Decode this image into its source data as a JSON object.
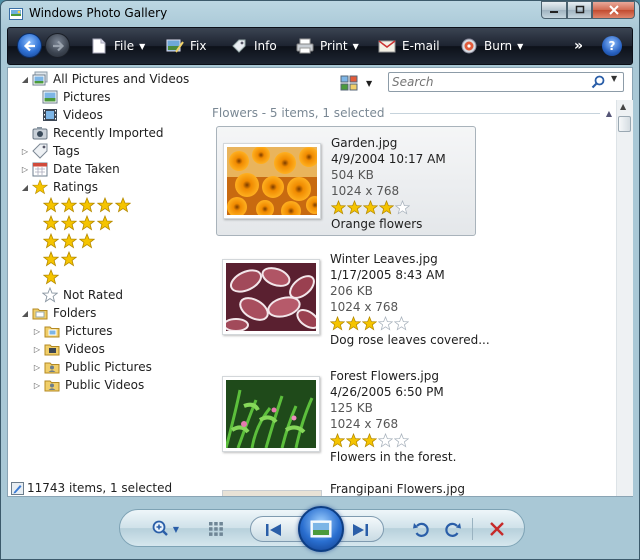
{
  "window": {
    "title": "Windows Photo Gallery"
  },
  "toolbar": {
    "file": "File",
    "fix": "Fix",
    "info": "Info",
    "print": "Print",
    "email": "E-mail",
    "burn": "Burn",
    "more": "»",
    "help": "?"
  },
  "nav": {
    "all": "All Pictures and Videos",
    "pictures": "Pictures",
    "videos": "Videos",
    "recently_imported": "Recently Imported",
    "tags": "Tags",
    "date_taken": "Date Taken",
    "ratings": "Ratings",
    "not_rated": "Not Rated",
    "folders": "Folders",
    "folder_pictures": "Pictures",
    "folder_videos": "Videos",
    "public_pictures": "Public Pictures",
    "public_videos": "Public Videos"
  },
  "status": {
    "text": "11743 items, 1 selected"
  },
  "search": {
    "placeholder": "Search"
  },
  "group": {
    "header": "Flowers - 5 items, 1 selected"
  },
  "photos": [
    {
      "name": "Garden.jpg",
      "date": "4/9/2004 10:17 AM",
      "size": "504 KB",
      "dims": "1024 x 768",
      "rating": 4,
      "caption": "Orange flowers"
    },
    {
      "name": "Winter Leaves.jpg",
      "date": "1/17/2005 8:43 AM",
      "size": "206 KB",
      "dims": "1024 x 768",
      "rating": 3,
      "caption": "Dog rose leaves covered..."
    },
    {
      "name": "Forest Flowers.jpg",
      "date": "4/26/2005 6:50 PM",
      "size": "125 KB",
      "dims": "1024 x 768",
      "rating": 3,
      "caption": "Flowers in the forest."
    },
    {
      "name": "Frangipani Flowers.jpg"
    }
  ],
  "colors": {
    "toolbar_dark": "#1d2330",
    "accent_blue": "#2a6fd0",
    "star_gold": "#f5c400",
    "delete_red": "#c62a2a"
  }
}
